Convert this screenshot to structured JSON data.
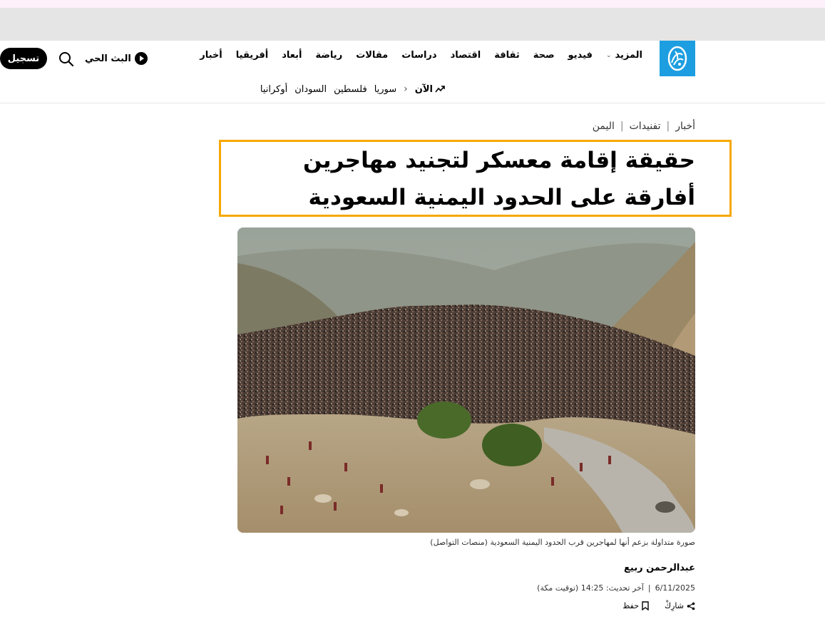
{
  "header": {
    "nav_items": [
      "أخبار",
      "أفريقيا",
      "أبعاد",
      "رياضة",
      "مقالات",
      "دراسات",
      "اقتصاد",
      "ثقافة",
      "صحة",
      "فيديو"
    ],
    "more_label": "المزيد",
    "live_label": "البث الحي",
    "signup_label": "تسجيل",
    "now_label": "الآن",
    "trending": [
      "سوريا",
      "فلسطين",
      "السودان",
      "أوكرانيا"
    ]
  },
  "article": {
    "breadcrumb": [
      "أخبار",
      "تفنيدات",
      "اليمن"
    ],
    "headline": "حقيقة إقامة معسكر لتجنيد مهاجرين أفارقة على الحدود اليمنية السعودية",
    "caption": "صورة متداولة بزعم أنها لمهاجرين قرب الحدود اليمنية السعودية (منصات التواصل)",
    "author": "عبدالرحمن ربيع",
    "date": "6/11/2025",
    "updated": "آخر تحديث: 14:25 (توقيت مكة)",
    "share_label": "شارِكْ",
    "save_label": "حفظ"
  },
  "colors": {
    "brand": "#1d9ee0",
    "highlight": "#f7a800"
  },
  "icons": [
    "aljazeera-logo-icon",
    "chevron-down-icon",
    "play-icon",
    "search-icon",
    "trending-icon",
    "chevron-left-icon",
    "share-icon",
    "bookmark-icon"
  ]
}
